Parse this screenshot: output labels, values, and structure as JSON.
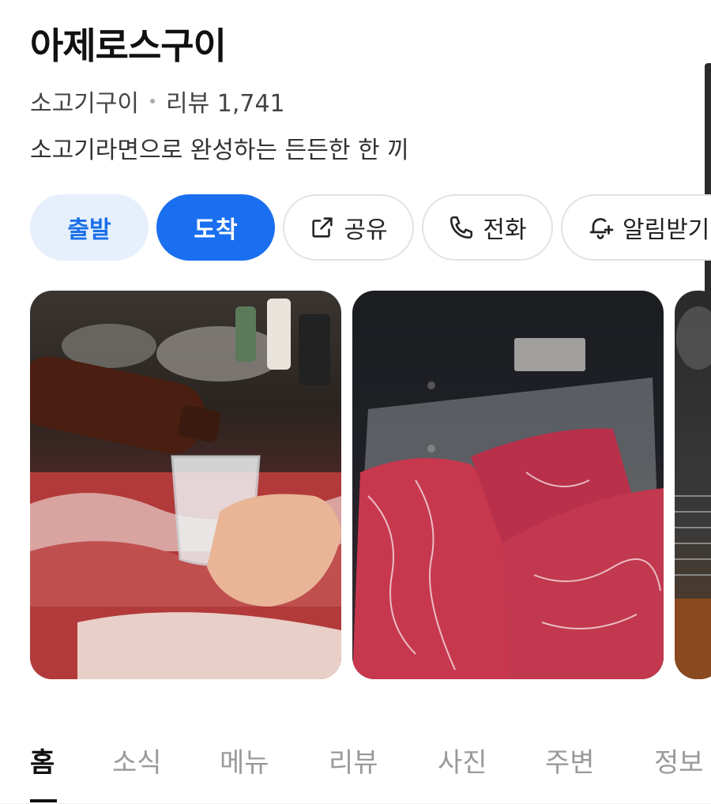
{
  "place": {
    "name": "아제로스구이",
    "category": "소고기구이",
    "review_label": "리뷰 1,741",
    "description": "소고기라면으로 완성하는 든든한 한 끼"
  },
  "actions": {
    "depart": "출발",
    "arrive": "도착",
    "share": "공유",
    "call": "전화",
    "alarm": "알림받기"
  },
  "photos": [
    {
      "icon": "soju-pouring-photo"
    },
    {
      "icon": "marbled-beef-package-photo"
    },
    {
      "icon": "grill-photo"
    }
  ],
  "tabs": [
    "홈",
    "소식",
    "메뉴",
    "리뷰",
    "사진",
    "주변",
    "정보"
  ],
  "active_tab": "홈",
  "colors": {
    "accent": "#1a6ff0",
    "accent_light": "#e6f0fd"
  }
}
